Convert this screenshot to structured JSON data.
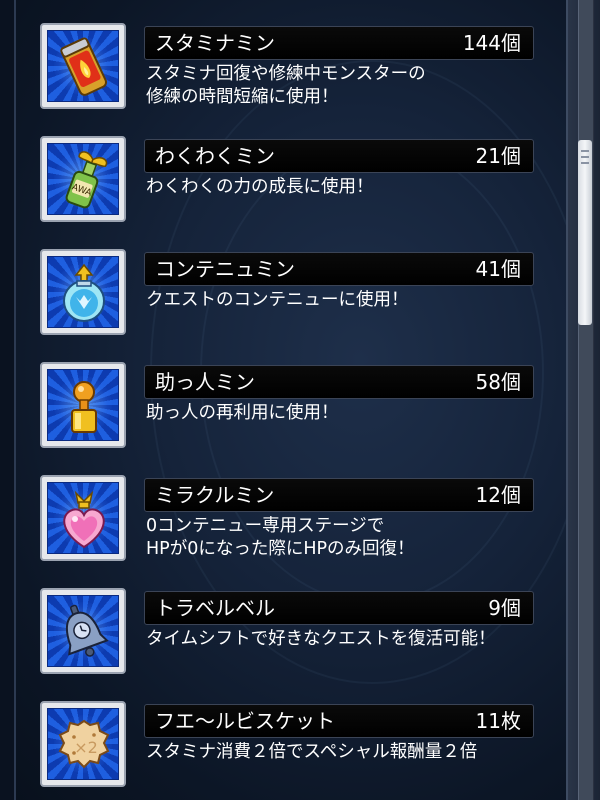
{
  "items": [
    {
      "name": "スタミナミン",
      "count": "144個",
      "desc": [
        "スタミナ回復や修練中モンスターの",
        "修練の時間短縮に使用！"
      ],
      "icon": "stamina-can-icon"
    },
    {
      "name": "わくわくミン",
      "count": "21個",
      "desc": [
        "わくわくの力の成長に使用！"
      ],
      "icon": "sprout-bottle-icon"
    },
    {
      "name": "コンテニュミン",
      "count": "41個",
      "desc": [
        "クエストのコンテニューに使用！"
      ],
      "icon": "continue-potion-icon"
    },
    {
      "name": "助っ人ミン",
      "count": "58個",
      "desc": [
        "助っ人の再利用に使用！"
      ],
      "icon": "helper-pawn-icon"
    },
    {
      "name": "ミラクルミン",
      "count": "12個",
      "desc": [
        "0コンテニュー専用ステージで",
        "HPが0になった際にHPのみ回復！"
      ],
      "icon": "heart-potion-icon"
    },
    {
      "name": "トラベルベル",
      "count": "9個",
      "desc": [
        "タイムシフトで好きなクエストを復活可能！"
      ],
      "icon": "bell-icon"
    },
    {
      "name": "フエ～ルビスケット",
      "count": "11枚",
      "desc": [
        "スタミナ消費２倍でスペシャル報酬量２倍"
      ],
      "icon": "biscuit-icon"
    }
  ]
}
